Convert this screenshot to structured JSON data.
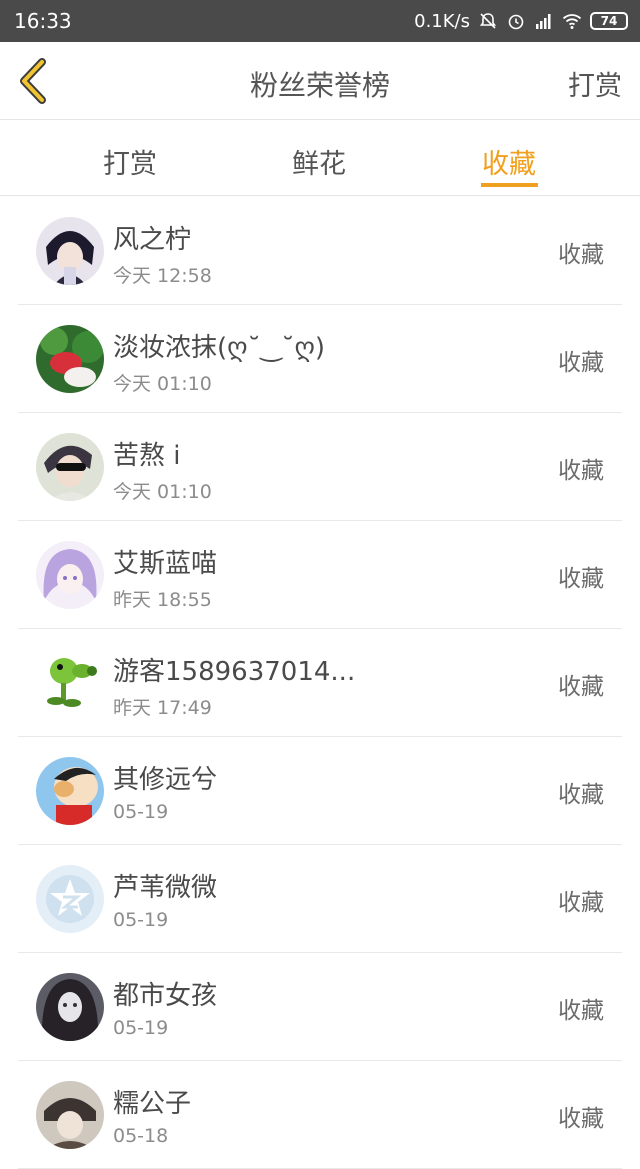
{
  "status_bar": {
    "time": "16:33",
    "network_speed": "0.1K/s",
    "battery": "74",
    "icons": [
      "bell-muted-icon",
      "alarm-icon",
      "signal-icon",
      "wifi-icon",
      "battery-icon"
    ]
  },
  "header": {
    "back_icon": "chevron-left-icon",
    "title": "粉丝荣誉榜",
    "action": "打赏"
  },
  "tabs": [
    {
      "label": "打赏",
      "active": false
    },
    {
      "label": "鲜花",
      "active": false
    },
    {
      "label": "收藏",
      "active": true
    }
  ],
  "colors": {
    "accent": "#f0a01e",
    "status_bar": "#4a4a4a",
    "text": "#4a4a4a",
    "subtext": "#8c8c8c"
  },
  "list": [
    {
      "name": "风之柠",
      "time": "今天 12:58",
      "type": "收藏"
    },
    {
      "name": "淡妆浓抹(ღ˘‿˘ღ)",
      "time": "今天 01:10",
      "type": "收藏"
    },
    {
      "name": "苦熬 i",
      "time": "今天 01:10",
      "type": "收藏"
    },
    {
      "name": "艾斯蓝喵",
      "time": "昨天 18:55",
      "type": "收藏"
    },
    {
      "name": "游客1589637014...",
      "time": "昨天 17:49",
      "type": "收藏"
    },
    {
      "name": "其修远兮",
      "time": "05-19",
      "type": "收藏"
    },
    {
      "name": "芦苇微微",
      "time": "05-19",
      "type": "收藏"
    },
    {
      "name": "都市女孩",
      "time": "05-19",
      "type": "收藏"
    },
    {
      "name": "糯公子",
      "time": "05-18",
      "type": "收藏"
    }
  ]
}
